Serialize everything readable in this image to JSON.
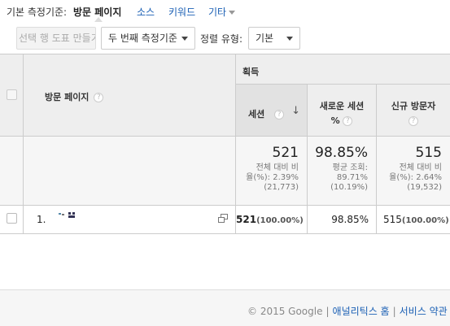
{
  "dimension_bar": {
    "prefix": "기본 측정기준:",
    "active": "방문 페이지",
    "links": [
      "소스",
      "키워드",
      "기타"
    ]
  },
  "toolbar": {
    "create_segment": "선택 행 도표 만들기",
    "second_dimension": "두 번째 측정기준",
    "sort_label": "정렬 유형:",
    "sort_value": "기본"
  },
  "table": {
    "page_header": "방문 페이지",
    "group_header": "획득",
    "columns": {
      "sessions": "세션",
      "new_sessions_line1": "새로운 세션",
      "new_sessions_line2": "%",
      "new_users": "신규 방문자"
    },
    "summary": {
      "sessions": {
        "value": "521",
        "line1": "전체 대비 비",
        "line2": "율(%): 2.39%",
        "line3": "(21,773)"
      },
      "new_sessions": {
        "value": "98.85%",
        "line1": "평균 조회:",
        "line2": "89.71%",
        "line3": "(10.19%)"
      },
      "new_users": {
        "value": "515",
        "line1": "전체 대비 비",
        "line2": "율(%): 2.64%",
        "line3": "(19,532)"
      }
    },
    "rows": [
      {
        "index": "1.",
        "sessions": "521",
        "sessions_pct": "(100.00%)",
        "new_sessions": "98.85%",
        "new_users": "515",
        "new_users_pct": "(100.00%)"
      }
    ]
  },
  "footer": {
    "copyright": "© 2015 Google",
    "link_home": "애널리틱스 홈",
    "link_terms": "서비스 약관"
  },
  "colors": {
    "link": "#1a5fb4",
    "header_bg": "#eeeeee",
    "sorted_col_bg": "#e2e2e2"
  }
}
